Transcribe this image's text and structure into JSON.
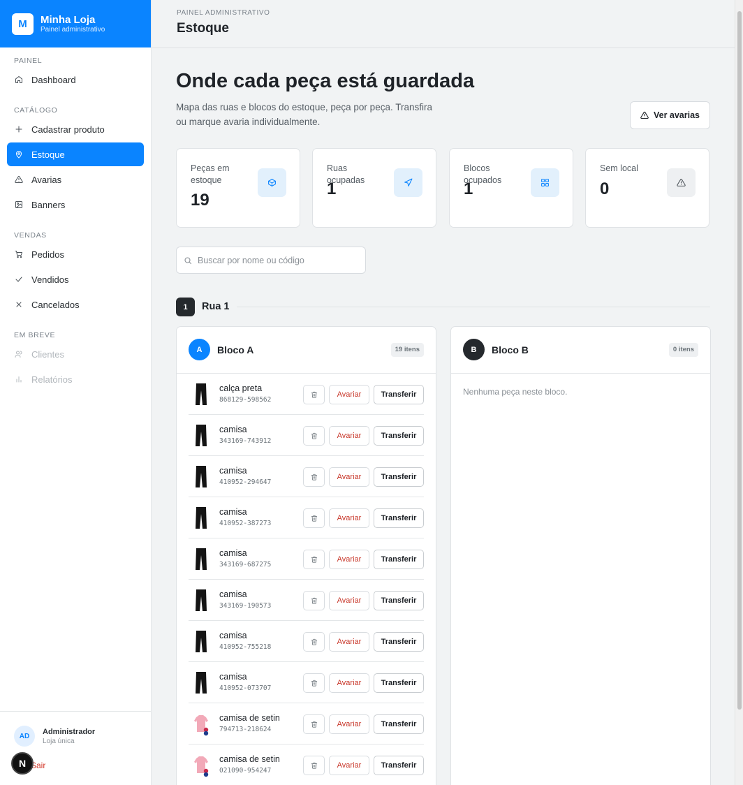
{
  "brand": {
    "logo_letter": "M",
    "name": "Minha Loja",
    "subtitle": "Painel administrativo"
  },
  "sidebar": {
    "sections": [
      {
        "heading": "PAINEL",
        "items": [
          {
            "label": "Dashboard",
            "icon": "home-icon"
          }
        ]
      },
      {
        "heading": "CATÁLOGO",
        "items": [
          {
            "label": "Cadastrar produto",
            "icon": "plus-icon"
          },
          {
            "label": "Estoque",
            "icon": "map-pin-icon",
            "active": true
          },
          {
            "label": "Avarias",
            "icon": "warning-icon"
          },
          {
            "label": "Banners",
            "icon": "image-icon"
          }
        ]
      },
      {
        "heading": "VENDAS",
        "items": [
          {
            "label": "Pedidos",
            "icon": "cart-icon"
          },
          {
            "label": "Vendidos",
            "icon": "check-icon"
          },
          {
            "label": "Cancelados",
            "icon": "x-icon"
          }
        ]
      },
      {
        "heading": "EM BREVE",
        "items": [
          {
            "label": "Clientes",
            "icon": "users-icon",
            "disabled": true
          },
          {
            "label": "Relatórios",
            "icon": "bar-chart-icon",
            "disabled": true
          }
        ]
      }
    ],
    "user": {
      "initials": "AD",
      "name": "Administrador",
      "subtitle": "Loja única"
    },
    "logout_label": "Sair",
    "next_badge": "N"
  },
  "header": {
    "breadcrumb": "PAINEL ADMINISTRATIVO",
    "title": "Estoque"
  },
  "hero": {
    "title": "Onde cada peça está guardada",
    "description": "Mapa das ruas e blocos do estoque, peça por peça. Transfira ou marque avaria individualmente.",
    "button_label": "Ver avarias"
  },
  "stats": [
    {
      "label": "Peças em estoque",
      "value": "19",
      "icon": "box-icon"
    },
    {
      "label": "Ruas ocupadas",
      "value": "1",
      "icon": "navigation-icon"
    },
    {
      "label": "Blocos ocupados",
      "value": "1",
      "icon": "grid-icon"
    },
    {
      "label": "Sem local",
      "value": "0",
      "icon": "warning-icon"
    }
  ],
  "search": {
    "placeholder": "Buscar por nome ou código",
    "value": ""
  },
  "rua": {
    "number": "1",
    "label": "Rua 1"
  },
  "blocks": [
    {
      "letter": "A",
      "name": "Bloco A",
      "count": "19 itens",
      "color": "#0a84ff",
      "items": [
        {
          "name": "calça preta",
          "code": "868129-598562",
          "image": "pants"
        },
        {
          "name": "camisa",
          "code": "343169-743912",
          "image": "pants"
        },
        {
          "name": "camisa",
          "code": "410952-294647",
          "image": "pants"
        },
        {
          "name": "camisa",
          "code": "410952-387273",
          "image": "pants"
        },
        {
          "name": "camisa",
          "code": "343169-687275",
          "image": "pants"
        },
        {
          "name": "camisa",
          "code": "343169-190573",
          "image": "pants"
        },
        {
          "name": "camisa",
          "code": "410952-755218",
          "image": "pants"
        },
        {
          "name": "camisa",
          "code": "410952-073707",
          "image": "pants"
        },
        {
          "name": "camisa de setin",
          "code": "794713-218624",
          "image": "shirt"
        },
        {
          "name": "camisa de setin",
          "code": "021090-954247",
          "image": "shirt"
        }
      ]
    },
    {
      "letter": "B",
      "name": "Bloco B",
      "count": "0 itens",
      "color": "#25292d",
      "empty_text": "Nenhuma peça neste bloco.",
      "items": []
    }
  ],
  "row_actions": {
    "avariar": "Avariar",
    "transferir": "Transferir"
  },
  "colors": {
    "accent": "#0a84ff",
    "danger": "#c8372a",
    "dark": "#25292d"
  }
}
